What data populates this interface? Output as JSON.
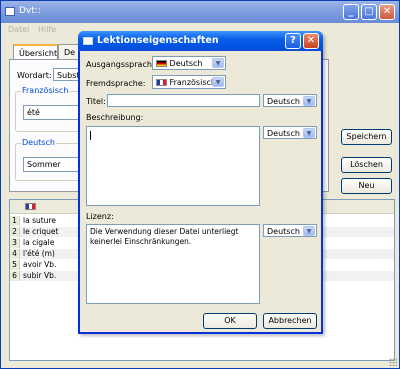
{
  "main": {
    "title": "Dvt::",
    "menu": [
      "Datei",
      "Hilfe"
    ],
    "tabs": [
      "Übersicht",
      "De"
    ],
    "wordart_label": "Wordart:",
    "wordart_value": "Substa",
    "group_fr_label": "Französisch",
    "group_fr_value": "été",
    "group_de_label": "Deutsch",
    "group_de_value": "Sommer",
    "buttons": {
      "save": "Speichern",
      "delete": "Löschen",
      "new": "Neu"
    },
    "table": {
      "rows": [
        {
          "num": "1",
          "text": "la suture"
        },
        {
          "num": "2",
          "text": "le criquet"
        },
        {
          "num": "3",
          "text": "la cigale"
        },
        {
          "num": "4",
          "text": "l'été (m)"
        },
        {
          "num": "5",
          "text": "avoir  Vb."
        },
        {
          "num": "6",
          "text": "subir  Vb."
        }
      ]
    }
  },
  "dialog": {
    "title": "Lektionseigenschaften",
    "source_lang_label": "Ausgangssprache:",
    "source_lang_value": "Deutsch",
    "foreign_lang_label": "Fremdsprache:",
    "foreign_lang_value": "Französisch",
    "title_label": "Titel:",
    "title_value": "",
    "title_lang": "Deutsch",
    "description_label": "Beschreibung:",
    "description_lang": "Deutsch",
    "license_label": "Lizenz:",
    "license_text": "Die Verwendung dieser Datei unterliegt keinerlei Einschränkungen.",
    "license_lang": "Deutsch",
    "ok": "OK",
    "cancel": "Abbrechen",
    "help_glyph": "?",
    "close_glyph": "✕"
  },
  "colors": {
    "dialog_title": "#0054e3",
    "main_title": "#7f9fdf",
    "group_label": "#0046d5"
  },
  "icons": [
    "app-icon",
    "help-icon",
    "close-icon",
    "minimize-icon",
    "maximize-icon",
    "german-flag-icon",
    "french-flag-icon",
    "dropdown-arrow-icon",
    "resize-grip-icon"
  ]
}
